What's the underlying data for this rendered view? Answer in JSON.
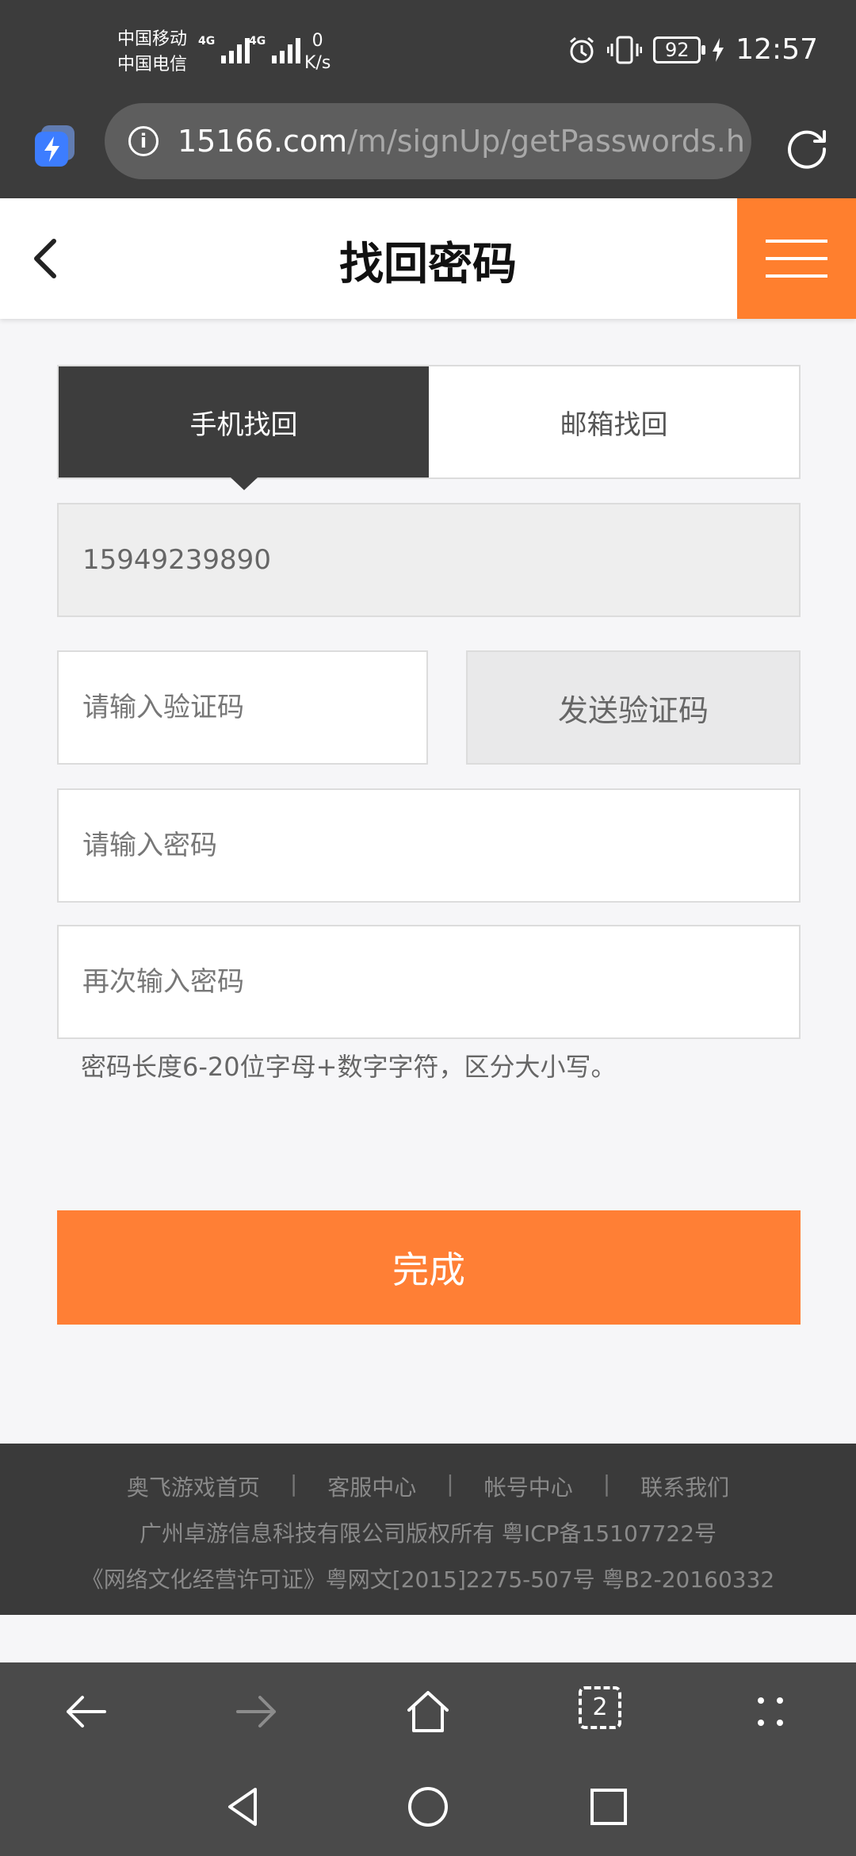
{
  "status_bar": {
    "carrier_1": "中国移动",
    "carrier_2": "中国电信",
    "network_1": "4G",
    "network_2": "4G",
    "speed_value": "0",
    "speed_unit": "K/s",
    "battery": "92",
    "time": "12:57"
  },
  "browser": {
    "url_host": "15166.com",
    "url_path": "/m/signUp/getPasswords.h"
  },
  "header": {
    "title": "找回密码"
  },
  "tabs": [
    {
      "label": "手机找回",
      "active": true
    },
    {
      "label": "邮箱找回",
      "active": false
    }
  ],
  "form": {
    "phone_value": "15949239890",
    "code_placeholder": "请输入验证码",
    "send_code_label": "发送验证码",
    "password_placeholder": "请输入密码",
    "confirm_placeholder": "再次输入密码",
    "hint": "密码长度6-20位字母+数字字符，区分大小写。",
    "submit_label": "完成"
  },
  "footer": {
    "links": [
      "奥飞游戏首页",
      "客服中心",
      "帐号中心",
      "联系我们"
    ],
    "separator": "|",
    "copyright": "广州卓游信息科技有限公司版权所有 粤ICP备15107722号",
    "license": "《网络文化经营许可证》粤网文[2015]2275-507号 粤B2-20160332"
  },
  "toolbar": {
    "tabs_count": "2"
  },
  "colors": {
    "accent": "#ff7f35",
    "dark_tab": "#3d3d3d",
    "footer_bg": "#3a3a3a"
  }
}
